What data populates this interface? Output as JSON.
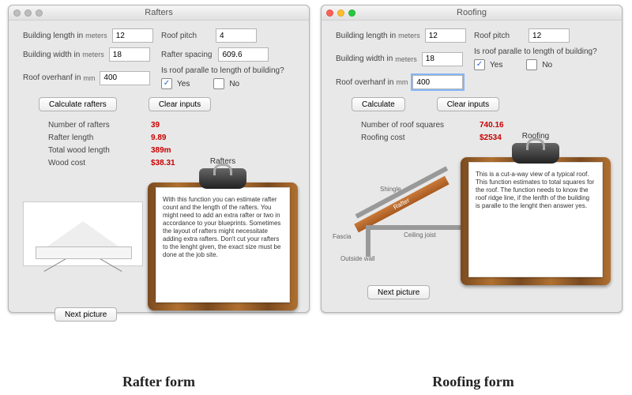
{
  "left": {
    "title": "Rafters",
    "inputs": {
      "building_length_label": "Building length in",
      "building_length_unit": "meters",
      "building_length_value": "12",
      "building_width_label": "Building width in",
      "building_width_unit": "meters",
      "building_width_value": "18",
      "roof_overhang_label": "Roof overhanf in",
      "roof_overhang_unit": "mm",
      "roof_overhang_value": "400",
      "roof_pitch_label": "Roof pitch",
      "roof_pitch_value": "4",
      "rafter_spacing_label": "Rafter spacing",
      "rafter_spacing_value": "609.6",
      "parallel_question": "Is roof paralle to length of building?",
      "yes_label": "Yes",
      "no_label": "No",
      "yes_checked": true,
      "no_checked": false
    },
    "buttons": {
      "calculate": "Calculate rafters",
      "clear": "Clear inputs",
      "next_picture": "Next picture"
    },
    "results": [
      {
        "label": "Number of rafters",
        "value": "39"
      },
      {
        "label": "Rafter length",
        "value": "9.89"
      },
      {
        "label": "Total wood length",
        "value": "389m"
      },
      {
        "label": "Wood cost",
        "value": "$38.31"
      }
    ],
    "clipboard": {
      "title": "Rafters",
      "text": "With this function you can estimate rafter count and the length of the rafters. You might need to add an extra rafter or two in accordance to your blueprints. Sometimes the layout of rafters might necessitate adding extra rafters. Don't cut your rafters to the lenght given, the exact size must be done at the job site."
    },
    "caption": "Rafter form"
  },
  "right": {
    "title": "Roofing",
    "inputs": {
      "building_length_label": "Building length in",
      "building_length_unit": "meters",
      "building_length_value": "12",
      "building_width_label": "Building width in",
      "building_width_unit": "meters",
      "building_width_value": "18",
      "roof_overhang_label": "Roof overhanf in",
      "roof_overhang_unit": "mm",
      "roof_overhang_value": "400",
      "roof_pitch_label": "Roof pitch",
      "roof_pitch_value": "12",
      "parallel_question": "Is roof paralle to length of building?",
      "yes_label": "Yes",
      "no_label": "No",
      "yes_checked": true,
      "no_checked": false
    },
    "buttons": {
      "calculate": "Calculate",
      "clear": "Clear inputs",
      "next_picture": "Next picture"
    },
    "results": [
      {
        "label": "Number of roof squares",
        "value": "740.16"
      },
      {
        "label": "Roofing cost",
        "value": "$2534"
      }
    ],
    "clipboard": {
      "title": "Roofing",
      "text": "This is a cut-a-way view of a typical roof. This function estimates to total squares for the roof. The function needs to know the roof ridge line, if the lenfth of the building is paralle to the lenght then answer yes."
    },
    "diagram_labels": {
      "shingle": "Shingle",
      "rafter": "Rafter",
      "ceiling_joist": "Ceiling joist",
      "fascia": "Fascia",
      "outside_wall": "Outside wall"
    },
    "caption": "Roofing form"
  }
}
